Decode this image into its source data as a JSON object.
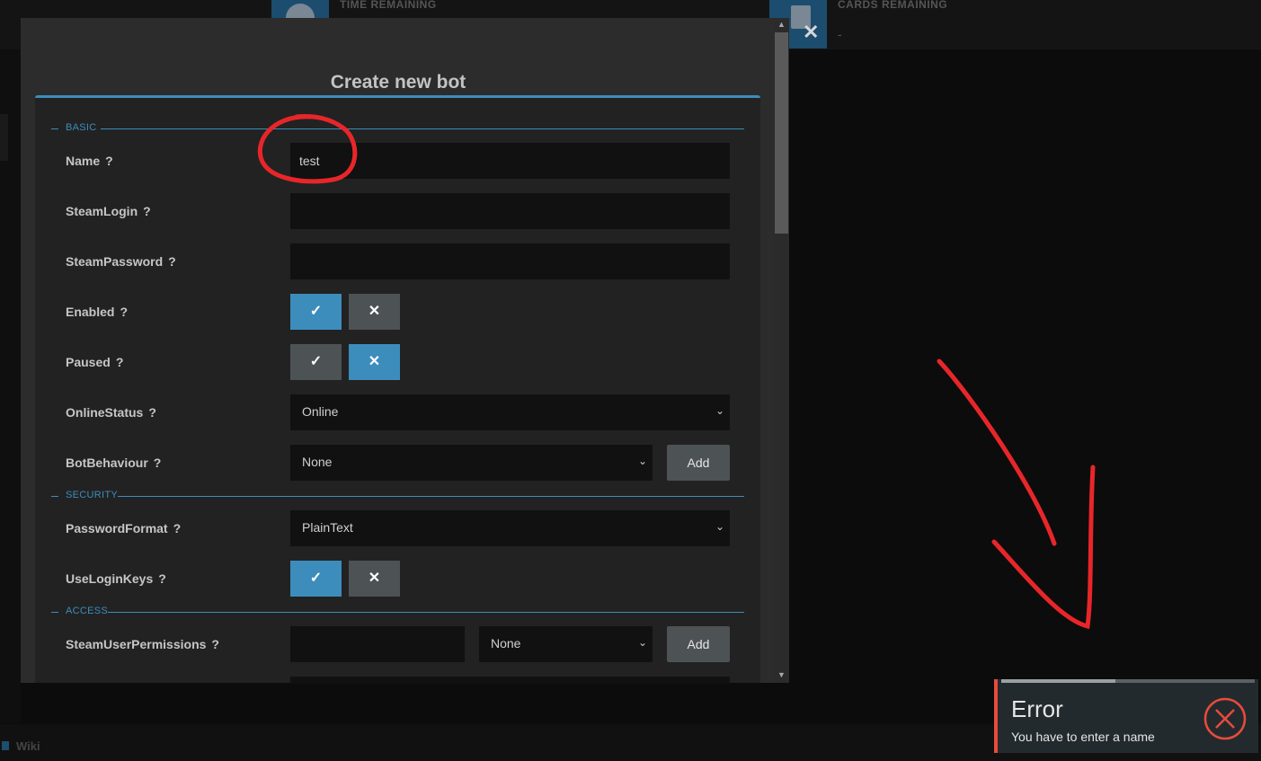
{
  "background": {
    "stats": [
      {
        "label": "TIME REMAINING",
        "icon": "clock-icon"
      },
      {
        "label": "CARDS REMAINING",
        "value": "-",
        "icon": "card-icon"
      }
    ],
    "footer": {
      "wiki_label": "Wiki"
    }
  },
  "modal": {
    "title": "Create new bot",
    "close_label": "✕"
  },
  "form": {
    "sections": {
      "basic": "BASIC",
      "security": "SECURITY",
      "access": "ACCESS"
    },
    "help_glyph": "?",
    "fields": {
      "name": {
        "label": "Name",
        "value": "test"
      },
      "steam_login": {
        "label": "SteamLogin",
        "value": ""
      },
      "steam_password": {
        "label": "SteamPassword",
        "value": ""
      },
      "enabled": {
        "label": "Enabled",
        "state": true
      },
      "paused": {
        "label": "Paused",
        "state": false
      },
      "online_status": {
        "label": "OnlineStatus",
        "selected": "Online"
      },
      "bot_behaviour": {
        "label": "BotBehaviour",
        "selected": "None",
        "add_label": "Add"
      },
      "password_format": {
        "label": "PasswordFormat",
        "selected": "PlainText"
      },
      "use_login_keys": {
        "label": "UseLoginKeys",
        "state": true
      },
      "steam_user_permissions": {
        "label": "SteamUserPermissions",
        "value": "",
        "selected": "None",
        "add_label": "Add"
      }
    },
    "toggle_glyphs": {
      "on": "✓",
      "off": "✕"
    }
  },
  "toast": {
    "title": "Error",
    "message": "You have to enter a name",
    "accent": "#e84b3c",
    "progress": 0.45
  },
  "colors": {
    "accent": "#3c8dbc",
    "annotation": "#e8262a"
  }
}
